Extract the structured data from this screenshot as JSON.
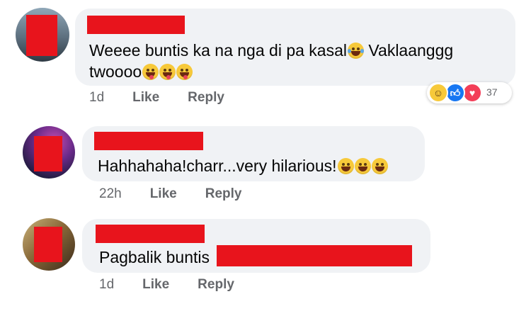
{
  "comments": [
    {
      "text": "Weeee buntis ka na nga di pa kasal",
      "text_tail": " Vaklaanggg",
      "line2": "twoooo",
      "time": "1d",
      "like_label": "Like",
      "reply_label": "Reply",
      "reaction_count": "37",
      "reaction_icons": [
        "haha-icon",
        "like-icon",
        "love-icon"
      ]
    },
    {
      "text": "Hahhahaha!charr...very hilarious!",
      "time": "22h",
      "like_label": "Like",
      "reply_label": "Reply"
    },
    {
      "text": "Pagbalik buntis",
      "time": "1d",
      "like_label": "Like",
      "reply_label": "Reply"
    }
  ],
  "colors": {
    "bubble": "#f0f2f5",
    "redaction": "#e8141c",
    "meta": "#65676b",
    "text": "#050505"
  }
}
